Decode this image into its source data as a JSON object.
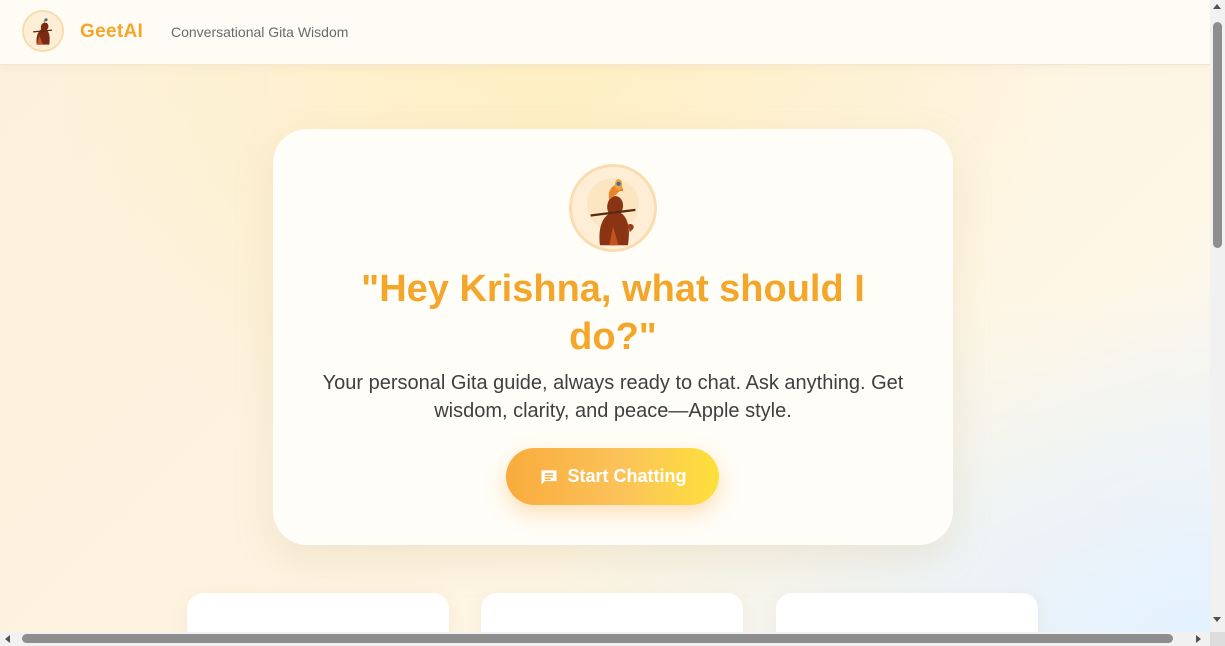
{
  "header": {
    "brand": "GeetAI",
    "tagline": "Conversational Gita Wisdom",
    "logo_icon": "krishna-logo-icon"
  },
  "hero": {
    "avatar_icon": "krishna-avatar-icon",
    "headline": "\"Hey Krishna, what should I do?\"",
    "subtext": "Your personal Gita guide, always ready to chat. Ask anything. Get wisdom, clarity, and peace—Apple style.",
    "cta_label": "Start Chatting",
    "cta_icon": "chat-icon"
  },
  "colors": {
    "accent": "#f4a62a",
    "button_gradient_start": "#f9ab3c",
    "button_gradient_end": "#fde03a",
    "text_primary": "#3f3f3f"
  }
}
